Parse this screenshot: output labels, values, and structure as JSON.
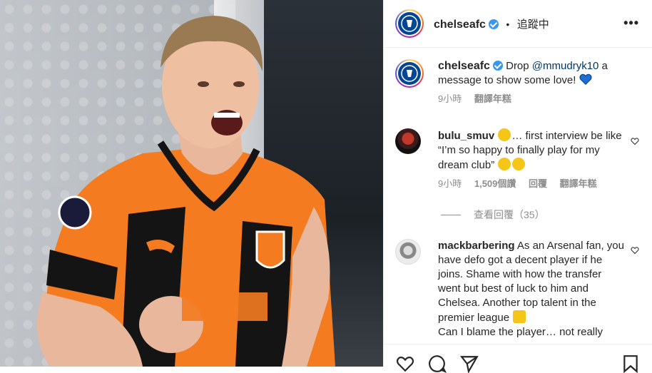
{
  "post": {
    "account": "chelseafc",
    "follow_status": "追蹤中",
    "separator": "•",
    "more_label": "•••"
  },
  "caption": {
    "username": "chelseafc",
    "text_before": "Drop ",
    "mention": "@mmudryk10",
    "text_after": " a message to show some love!",
    "emoji": "blue-heart",
    "time": "9小時",
    "translate": "翻譯年糕"
  },
  "comments": [
    {
      "username": "bulu_smuv",
      "emoji_before": "face-with-hand-over-mouth",
      "text": "… first interview be like “I’m so happy to finally play for my dream club”",
      "emoji_after": [
        "laughing-face",
        "laughing-face"
      ],
      "time": "9小時",
      "likes": "1,509個讚",
      "reply": "回覆",
      "translate": "翻譯年糕",
      "view_replies": "查看回覆（35）"
    },
    {
      "username": "mackbarbering",
      "text": "As an Arsenal fan, you have defo got a decent player if he joins. Shame with how the transfer went but best of luck to him and Chelsea. Another top talent in the premier league",
      "emoji_mid": "thumbs-up",
      "text_tail": "Can I blame the player… not really"
    }
  ],
  "colors": {
    "chelsea_blue": "#034694",
    "verified_blue": "#3897f0",
    "mention": "#00376b",
    "meta_gray": "#8e8e8e",
    "jersey_orange": "#f47b20"
  },
  "icons": [
    "heart-icon",
    "comment-icon",
    "share-icon",
    "bookmark-icon",
    "more-icon",
    "verified-icon"
  ]
}
